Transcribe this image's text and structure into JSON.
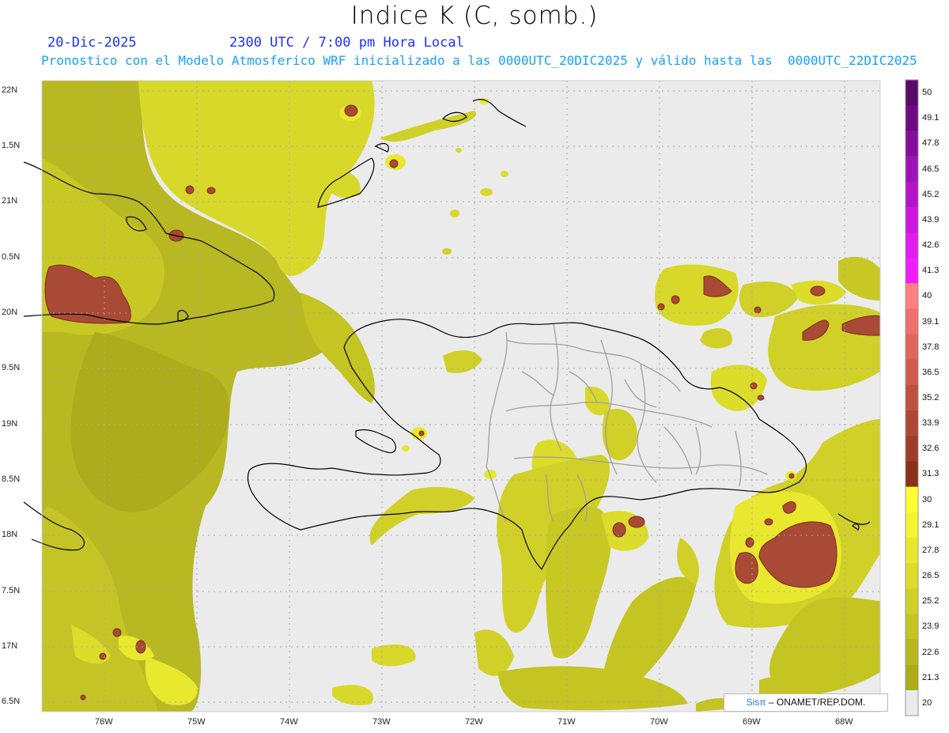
{
  "header": {
    "title": "Indice K (C, somb.)",
    "date": "20-Dic-2025",
    "time": "2300 UTC / 7:00 pm Hora Local",
    "forecast": "Pronostico con el Modelo Atmosferico WRF inicializado a las 0000UTC_20DIC2025 y válido hasta las  0000UTC_22DIC2025"
  },
  "axes": {
    "lat_labels": [
      "22N",
      "1.5N",
      "21N",
      "0.5N",
      "20N",
      "9.5N",
      "19N",
      "8.5N",
      "18N",
      "7.5N",
      "17N",
      "6.5N"
    ],
    "lon_labels": [
      "76W",
      "75W",
      "74W",
      "73W",
      "72W",
      "71W",
      "70W",
      "69W",
      "68W"
    ]
  },
  "colorbar": {
    "labels": [
      "50",
      "49.1",
      "47.8",
      "46.5",
      "45.2",
      "43.9",
      "42.6",
      "41.3",
      "40",
      "39.1",
      "37.8",
      "36.5",
      "35.2",
      "33.9",
      "32.6",
      "31.3",
      "30",
      "29.1",
      "27.8",
      "26.5",
      "25.2",
      "23.9",
      "22.6",
      "21.3",
      "20"
    ],
    "colors": [
      "#5a0a6a",
      "#6e0a82",
      "#860e9c",
      "#9e12b8",
      "#b414cc",
      "#cc18e0",
      "#e01cf0",
      "#f01cff",
      "#ff8080",
      "#f0706e",
      "#e0665c",
      "#d05a4c",
      "#c0503e",
      "#b04634",
      "#a03c2a",
      "#8a3018",
      "#ffff33",
      "#f4f431",
      "#e8e82e",
      "#dcdc2b",
      "#d0d028",
      "#c4c422",
      "#b8b81e",
      "#acac18"
    ]
  },
  "credit": {
    "brand": "Sisπ",
    "text": "– ONAMET/REP.DOM."
  }
}
